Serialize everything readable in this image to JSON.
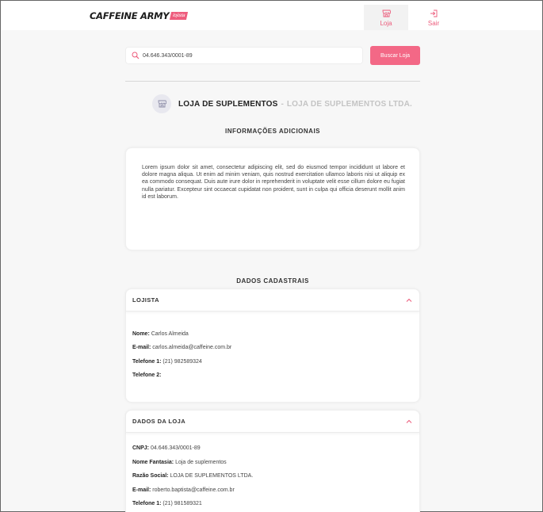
{
  "header": {
    "logo_text": "CAFFEINE ARMY",
    "logo_tag": "lojista",
    "nav": [
      {
        "label": "Loja",
        "icon": "store-icon",
        "active": true
      },
      {
        "label": "Sair",
        "icon": "logout-icon",
        "active": false
      }
    ]
  },
  "search": {
    "value": "04.646.343/0001-89",
    "button_label": "Buscar Loja"
  },
  "store": {
    "name": "LOJA DE SUPLEMENTOS",
    "separator": "-",
    "legal_name": "LOJA DE SUPLEMENTOS LTDA."
  },
  "info": {
    "heading": "INFORMAÇÕES ADICIONAIS",
    "text": "Lorem ipsum dolor sit amet, consectetur adipiscing elit, sed do eiusmod tempor incididunt ut labore et dolore magna aliqua. Ut enim ad minim veniam, quis nostrud exercitation ullamco laboris nisi ut aliquip ex ea commodo consequat. Duis aute irure dolor in reprehenderit in voluptate velit esse cillum dolore eu fugiat nulla pariatur. Excepteur sint occaecat cupidatat non proident, sunt in culpa qui officia deserunt mollit anim id est laborum."
  },
  "dados": {
    "heading": "DADOS CADASTRAIS",
    "lojista": {
      "title": "LOJISTA",
      "fields": [
        {
          "label": "Nome:",
          "value": "Carlos Almeida"
        },
        {
          "label": "E-mail:",
          "value": "carlos.almeida@caffeine.com.br"
        },
        {
          "label": "Telefone 1:",
          "value": "(21) 982589324"
        },
        {
          "label": "Telefone 2:",
          "value": ""
        }
      ]
    },
    "loja": {
      "title": "DADOS DA LOJA",
      "fields": [
        {
          "label": "CNPJ:",
          "value": "04.646.343/0001-89"
        },
        {
          "label": "Nome Fantasia:",
          "value": "Loja de suplementos"
        },
        {
          "label": "Razão Social:",
          "value": "LOJA DE SUPLEMENTOS LTDA."
        },
        {
          "label": "E-mail:",
          "value": "roberto.baptista@caffeine.com.br"
        },
        {
          "label": "Telefone 1:",
          "value": "(21) 981589321"
        }
      ]
    }
  },
  "colors": {
    "accent": "#f36886",
    "nav_text": "#ec5b7b",
    "muted": "#c4c4c4"
  }
}
